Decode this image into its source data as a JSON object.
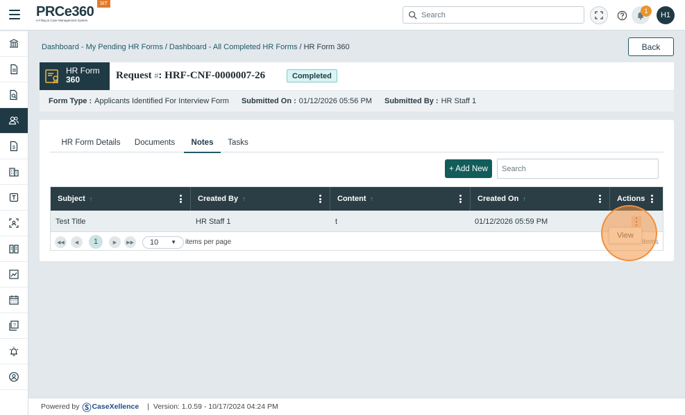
{
  "app": {
    "logo_text": "PRCe360",
    "logo_subtitle": "e-Filing & Case Management System",
    "env_badge": "SIT"
  },
  "topbar": {
    "search_placeholder": "Search",
    "notification_count": "1",
    "avatar_initials": "H1"
  },
  "breadcrumb": {
    "items": [
      "Dashboard - My Pending HR Forms",
      "Dashboard - All Completed HR Forms"
    ],
    "current": "HR Form 360"
  },
  "back_label": "Back",
  "header": {
    "badge_title": "HR Form",
    "badge_sub": "360",
    "request_prefix": "Request",
    "request_hash": "#",
    "request_id": "HRF-CNF-0000007-26",
    "status": "Completed"
  },
  "info": {
    "form_type_label": "Form Type :",
    "form_type_value": "Applicants Identified For Interview Form",
    "submitted_on_label": "Submitted On :",
    "submitted_on_value": "01/12/2026 05:56 PM",
    "submitted_by_label": "Submitted By :",
    "submitted_by_value": "HR Staff 1"
  },
  "tabs": [
    "HR Form Details",
    "Documents",
    "Notes",
    "Tasks"
  ],
  "active_tab": "Notes",
  "notes": {
    "add_new_label": "+ Add New",
    "search_placeholder": "Search",
    "columns": [
      "Subject",
      "Created By",
      "Content",
      "Created On",
      "Actions"
    ],
    "rows": [
      {
        "subject": "Test Title",
        "created_by": "HR Staff 1",
        "content": "t",
        "created_on": "01/12/2026 05:59 PM"
      }
    ],
    "pager": {
      "current_page": "1",
      "page_size": "10",
      "items_per_page_label": "items per page",
      "items_tail": "items"
    },
    "row_menu_view": "View"
  },
  "footer": {
    "powered_by": "Powered by",
    "brand": "CaseXellence",
    "separator": "|",
    "version": "Version: 1.0.59 - 10/17/2024 04:24 PM"
  }
}
